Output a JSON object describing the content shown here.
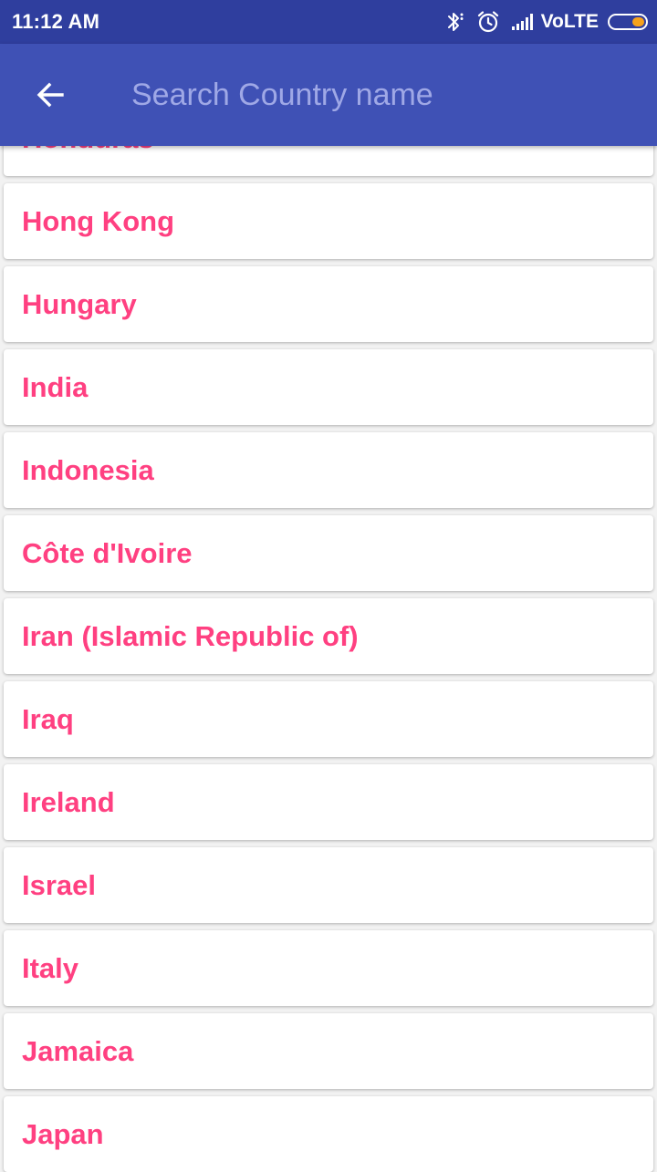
{
  "status_bar": {
    "time": "11:12 AM",
    "network_label": "VoLTE",
    "battery_level": 0.25,
    "battery_color": "#f6a21c",
    "icons": [
      "bluetooth-icon",
      "alarm-clock-icon",
      "signal-strength-icon",
      "battery-icon"
    ]
  },
  "app_bar": {
    "background": "#3f51b5",
    "back_icon": "arrow-left-icon",
    "search_placeholder": "Search Country name",
    "search_value": ""
  },
  "theme": {
    "country_text_color": "#ff4081",
    "card_background": "#ffffff"
  },
  "countries": [
    {
      "name": "Honduras"
    },
    {
      "name": "Hong Kong"
    },
    {
      "name": "Hungary"
    },
    {
      "name": "India"
    },
    {
      "name": "Indonesia"
    },
    {
      "name": "Côte d'Ivoire"
    },
    {
      "name": "Iran (Islamic Republic of)"
    },
    {
      "name": "Iraq"
    },
    {
      "name": "Ireland"
    },
    {
      "name": "Israel"
    },
    {
      "name": "Italy"
    },
    {
      "name": "Jamaica"
    },
    {
      "name": "Japan"
    }
  ]
}
